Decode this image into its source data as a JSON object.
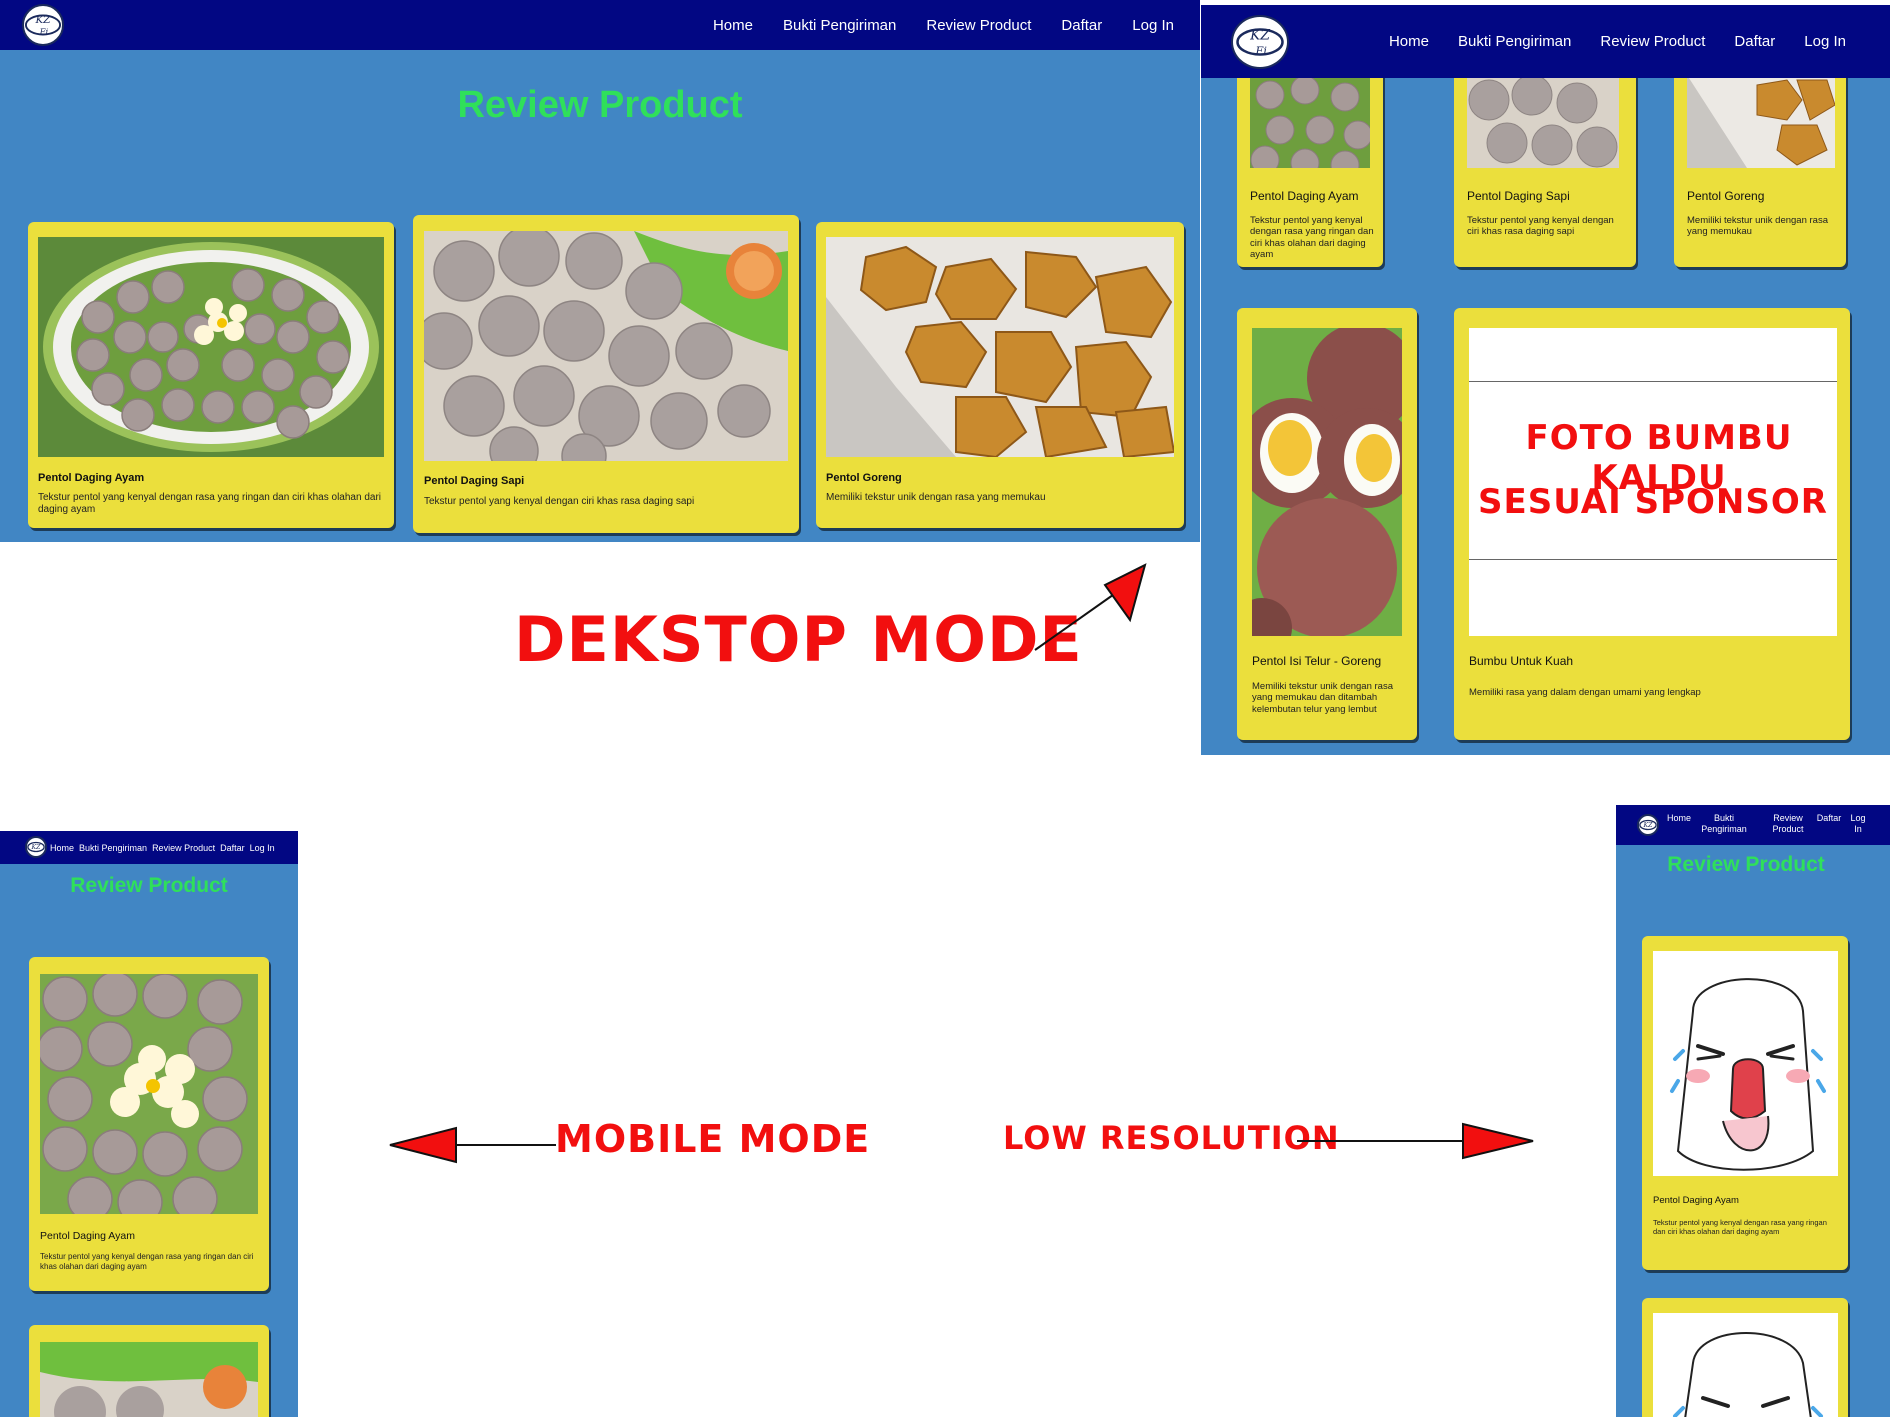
{
  "brand": {
    "logo_text": "KZ",
    "logo_sub": "Fi"
  },
  "nav": [
    "Home",
    "Bukti Pengiriman",
    "Review Product",
    "Daftar",
    "Log In"
  ],
  "nav_low_res": [
    {
      "line1": "Home",
      "line2": ""
    },
    {
      "line1": "Bukti",
      "line2": "Pengiriman"
    },
    {
      "line1": "Review",
      "line2": "Product"
    },
    {
      "line1": "Daftar",
      "line2": ""
    },
    {
      "line1": "Log",
      "line2": "In"
    }
  ],
  "page_title": "Review Product",
  "products": [
    {
      "name": "Pentol Daging Ayam",
      "desc": "Tekstur pentol yang kenyal dengan rasa yang ringan dan ciri khas olahan dari daging ayam"
    },
    {
      "name": "Pentol Daging Sapi",
      "desc": "Tekstur pentol yang kenyal dengan ciri khas rasa daging sapi"
    },
    {
      "name": "Pentol Goreng",
      "desc": "Memiliki tekstur unik dengan rasa yang memukau"
    },
    {
      "name": "Pentol Isi Telur - Goreng",
      "desc": "Memiliki tekstur unik dengan rasa yang memukau dan ditambah kelembutan telur yang lembut"
    },
    {
      "name": "Bumbu Untuk Kuah",
      "desc": "Memiliki rasa yang dalam dengan umami yang lengkap"
    }
  ],
  "sponsor_placeholder": {
    "line1": "FOTO BUMBU KALDU",
    "line2": "SESUAI SPONSOR"
  },
  "annotations": {
    "desktop": "DEKSTOP MODE",
    "mobile": "MOBILE MODE",
    "low_res": "LOW RESOLUTION"
  },
  "colors": {
    "navbar": "#020783",
    "background": "#4186c4",
    "card": "#ebdf3c",
    "title": "#2fe05a",
    "annotation": "#f20f0f"
  }
}
